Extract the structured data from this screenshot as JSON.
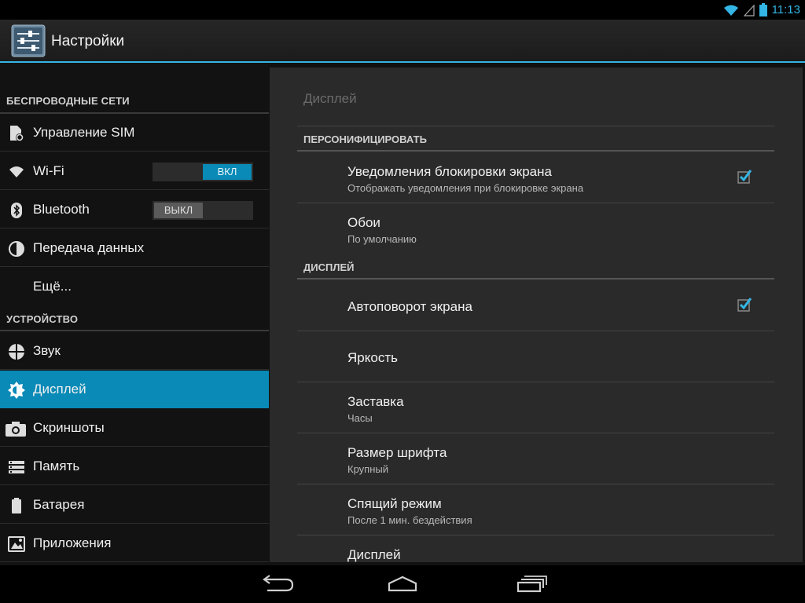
{
  "status": {
    "time": "11:13",
    "accent": "#33b5e5"
  },
  "actionbar": {
    "title": "Настройки",
    "icon": "settings-sliders-icon"
  },
  "sidebar": {
    "categories": [
      {
        "label": "БЕСПРОВОДНЫЕ СЕТИ"
      },
      {
        "label": "УСТРОЙСТВО"
      }
    ],
    "items": [
      {
        "label": "Управление SIM",
        "icon": "sim-card-icon"
      },
      {
        "label": "Wi-Fi",
        "icon": "wifi-icon",
        "toggle": "ВКЛ"
      },
      {
        "label": "Bluetooth",
        "icon": "bluetooth-icon",
        "toggle": "ВЫКЛ"
      },
      {
        "label": "Передача данных",
        "icon": "data-usage-icon"
      },
      {
        "label": "Ещё..."
      },
      {
        "label": "Звук",
        "icon": "sound-icon"
      },
      {
        "label": "Дисплей",
        "icon": "display-brightness-icon",
        "selected": true
      },
      {
        "label": "Скриншоты",
        "icon": "camera-icon"
      },
      {
        "label": "Память",
        "icon": "storage-icon"
      },
      {
        "label": "Батарея",
        "icon": "battery-icon"
      },
      {
        "label": "Приложения",
        "icon": "apps-icon"
      }
    ],
    "selected_color": "#0a8ab7"
  },
  "pane": {
    "title": "Дисплей",
    "sections": [
      {
        "header": "ПЕРСОНИФИЦИРОВАТЬ"
      },
      {
        "header": "ДИСПЛЕЙ"
      }
    ],
    "prefs": [
      {
        "title": "Уведомления блокировки экрана",
        "summary": "Отображать уведомления при блокировке экрана",
        "checked": true
      },
      {
        "title": "Обои",
        "summary": "По умолчанию"
      },
      {
        "title": "Автоповорот экрана",
        "checked": true
      },
      {
        "title": "Яркость"
      },
      {
        "title": "Заставка",
        "summary": "Часы"
      },
      {
        "title": "Размер шрифта",
        "summary": "Крупный"
      },
      {
        "title": "Спящий режим",
        "summary": "После 1 мин. бездействия"
      },
      {
        "title": "Дисплей"
      }
    ]
  },
  "navbar": {
    "buttons": [
      "back-icon",
      "home-icon",
      "recent-apps-icon"
    ]
  }
}
